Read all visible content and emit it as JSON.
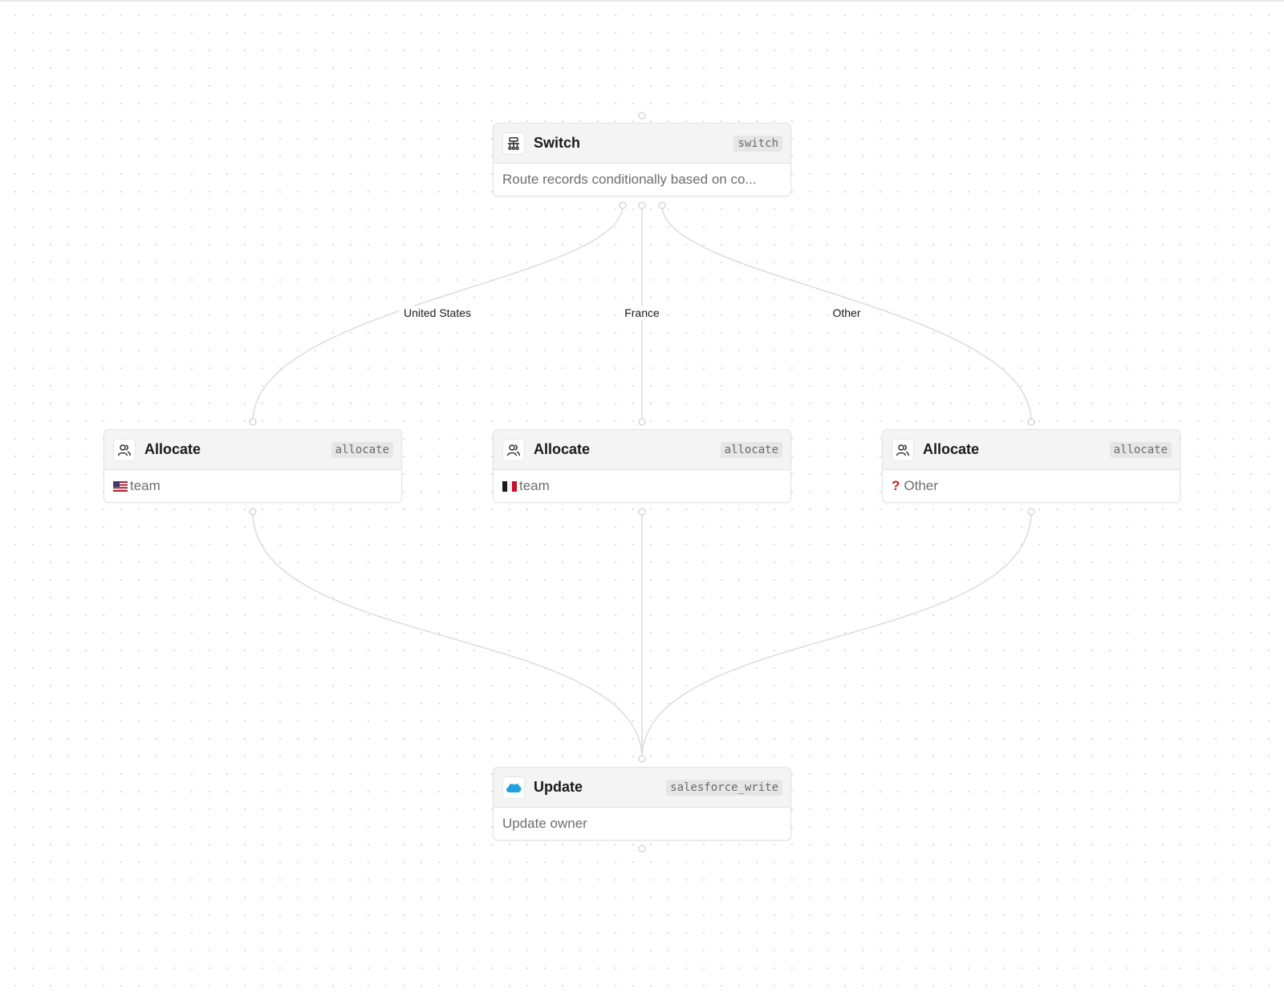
{
  "canvas": {
    "edges": [
      {
        "from": "switch",
        "to": "allocate-us",
        "label": "United States"
      },
      {
        "from": "switch",
        "to": "allocate-fr",
        "label": "France"
      },
      {
        "from": "switch",
        "to": "allocate-other",
        "label": "Other"
      },
      {
        "from": "allocate-us",
        "to": "update",
        "label": ""
      },
      {
        "from": "allocate-fr",
        "to": "update",
        "label": ""
      },
      {
        "from": "allocate-other",
        "to": "update",
        "label": ""
      }
    ]
  },
  "nodes": {
    "switch": {
      "title": "Switch",
      "badge": "switch",
      "description": "Route records conditionally based on co...",
      "icon": "switch-icon"
    },
    "allocate_us": {
      "title": "Allocate",
      "badge": "allocate",
      "body_text": "team",
      "body_icon": "us-flag-icon",
      "icon": "users-icon"
    },
    "allocate_fr": {
      "title": "Allocate",
      "badge": "allocate",
      "body_text": "team",
      "body_icon": "france-flag-icon",
      "icon": "users-icon"
    },
    "allocate_other": {
      "title": "Allocate",
      "badge": "allocate",
      "body_text": "Other",
      "body_icon": "question-mark-icon",
      "icon": "users-icon"
    },
    "update": {
      "title": "Update",
      "badge": "salesforce_write",
      "description": "Update owner",
      "icon": "salesforce-cloud-icon"
    }
  },
  "colors": {
    "edge": "#dcdcdc",
    "node_border": "#e3e3e3",
    "header_bg": "#f4f4f4",
    "salesforce_blue": "#1ea1dc",
    "question_red": "#c41e1e"
  }
}
